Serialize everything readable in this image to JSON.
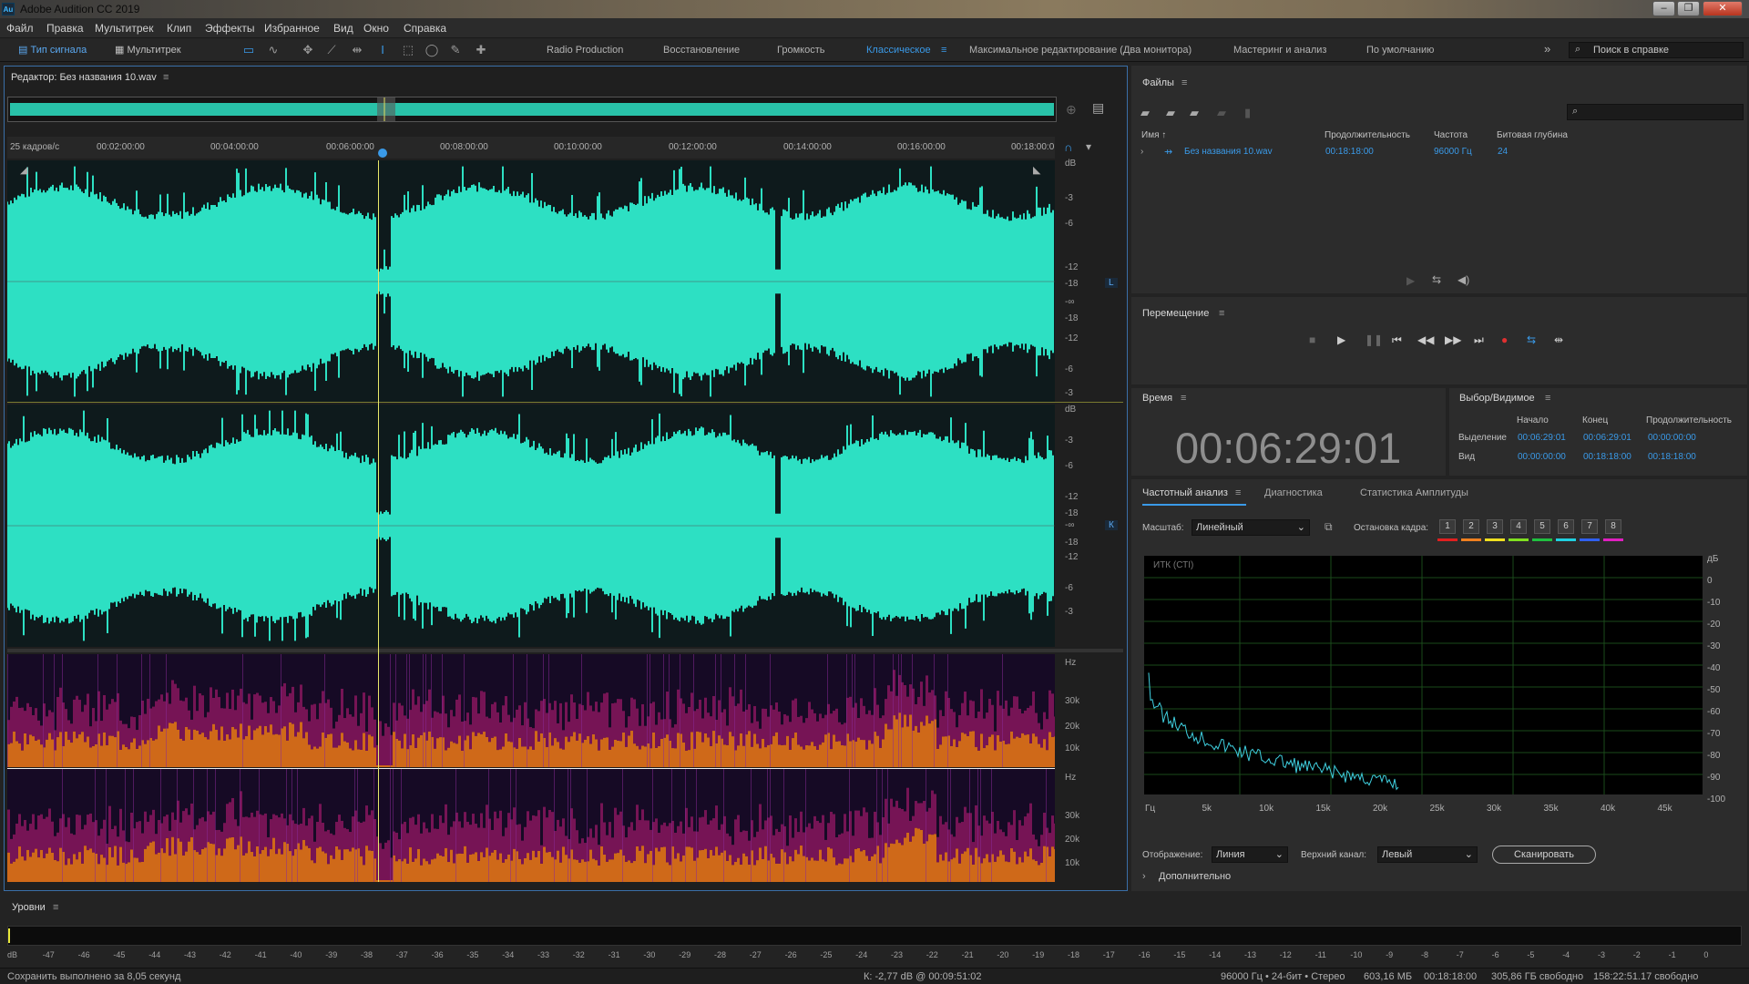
{
  "window": {
    "title": "Adobe Audition CC 2019",
    "icon": "Au"
  },
  "menu": [
    "Файл",
    "Правка",
    "Мультитрек",
    "Клип",
    "Эффекты",
    "Избранное",
    "Вид",
    "Окно",
    "Справка"
  ],
  "toolbar": {
    "waveform": "Тип сигнала",
    "multitrack": "Мультитрек"
  },
  "workspaces": [
    "Radio Production",
    "Восстановление",
    "Громкость",
    "Классическое",
    "Максимальное редактирование (Два монитора)",
    "Мастеринг и анализ",
    "По умолчанию"
  ],
  "active_workspace": "Классическое",
  "search": {
    "placeholder": "Поиск в справке"
  },
  "editor": {
    "title": "Редактор: Без названия 10.wav",
    "timecode_label": "25 кадров/с",
    "ruler": [
      "00:02:00:00",
      "00:04:00:00",
      "00:06:00:00",
      "00:08:00:00",
      "00:10:00:00",
      "00:12:00:00",
      "00:14:00:00",
      "00:16:00:00",
      "00:18:00:0"
    ],
    "db_top": [
      "dB",
      "-3",
      "-6",
      "-12",
      "-18",
      "-∞",
      "-18",
      "-12",
      "-6",
      "-3"
    ],
    "db_bottom": [
      "dB",
      "-3",
      "-6",
      "-12",
      "-18",
      "-∞",
      "-18",
      "-12",
      "-6",
      "-3"
    ],
    "channel_l": "L",
    "channel_r": "К",
    "hz_top": [
      "Hz",
      "30k",
      "20k",
      "10k"
    ],
    "hz_bottom": [
      "Hz",
      "30k",
      "20k",
      "10k"
    ],
    "waveform_color": "#2de0c3"
  },
  "files": {
    "title": "Файлы",
    "columns": [
      "Имя",
      "Продолжительность",
      "Частота",
      "Битовая глубина"
    ],
    "rows": [
      {
        "name": "Без названия 10.wav",
        "duration": "00:18:18:00",
        "rate": "96000 Гц",
        "depth": "24"
      }
    ]
  },
  "transport": {
    "title": "Перемещение"
  },
  "time": {
    "title": "Время",
    "value": "00:06:29:01"
  },
  "selection": {
    "title": "Выбор/Видимое",
    "headers": [
      "Начало",
      "Конец",
      "Продолжительность"
    ],
    "rows": [
      {
        "label": "Выделение",
        "start": "00:06:29:01",
        "end": "00:06:29:01",
        "dur": "00:00:00:00"
      },
      {
        "label": "Вид",
        "start": "00:00:00:00",
        "end": "00:18:18:00",
        "dur": "00:18:18:00"
      }
    ]
  },
  "freq": {
    "tabs": [
      "Частотный анализ",
      "Диагностика",
      "Статистика Амплитуды"
    ],
    "scale_label": "Масштаб:",
    "scale_value": "Линейный",
    "hold_label": "Остановка кадра:",
    "holds": [
      "1",
      "2",
      "3",
      "4",
      "5",
      "6",
      "7",
      "8"
    ],
    "hold_colors": [
      "#e02020",
      "#f08020",
      "#f0e020",
      "#80e020",
      "#20c040",
      "#20d0e0",
      "#3060f0",
      "#e020c0"
    ],
    "graph_label": "ИТК (СТI)",
    "db_labels": [
      "дБ",
      "0",
      "-10",
      "-20",
      "-30",
      "-40",
      "-50",
      "-60",
      "-70",
      "-80",
      "-90",
      "-100"
    ],
    "x_labels": [
      "Гц",
      "5k",
      "10k",
      "15k",
      "20k",
      "25k",
      "30k",
      "35k",
      "40k",
      "45k"
    ],
    "display_label": "Отображение:",
    "display_value": "Линия",
    "channel_label": "Верхний канал:",
    "channel_value": "Левый",
    "scan_button": "Сканировать",
    "advanced": "Дополнительно"
  },
  "levels": {
    "title": "Уровни",
    "scale": [
      "dB",
      "-47",
      "-46",
      "-45",
      "-44",
      "-43",
      "-42",
      "-41",
      "-40",
      "-39",
      "-38",
      "-37",
      "-36",
      "-35",
      "-34",
      "-33",
      "-32",
      "-31",
      "-30",
      "-29",
      "-28",
      "-27",
      "-26",
      "-25",
      "-24",
      "-23",
      "-22",
      "-21",
      "-20",
      "-19",
      "-18",
      "-17",
      "-16",
      "-15",
      "-14",
      "-13",
      "-12",
      "-11",
      "-10",
      "-9",
      "-8",
      "-7",
      "-6",
      "-5",
      "-4",
      "-3",
      "-2",
      "-1",
      "0"
    ]
  },
  "status": {
    "left": "Сохранить выполнено за 8,05 секунд",
    "cursor": "К: -2,77 dB @ 00:09:51:02",
    "format": "96000 Гц • 24-бит • Стерео",
    "size": "603,16 МБ",
    "duration": "00:18:18:00",
    "free": "305,86 ГБ свободно",
    "free_time": "158:22:51.17 свободно"
  }
}
